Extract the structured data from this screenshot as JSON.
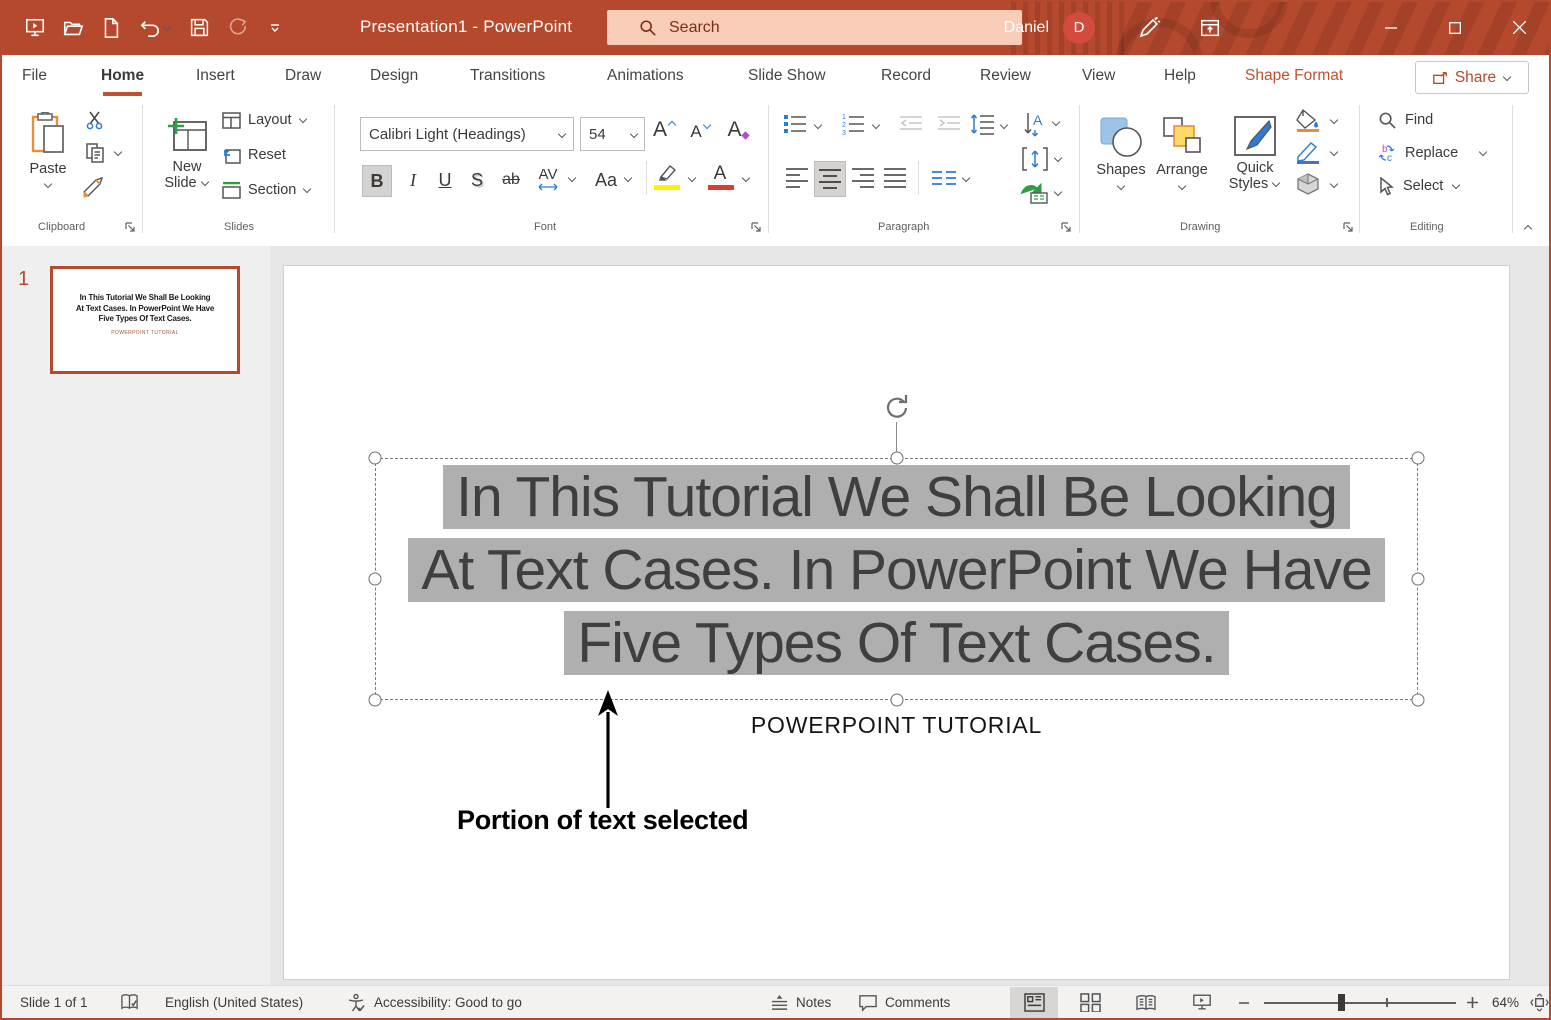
{
  "colors": {
    "accent": "#B5492D",
    "search_bg": "#F8CDB8",
    "selection_highlight": "#AFAFAF",
    "slide_text": "#3F3F3F",
    "contextual_tab": "#C0512F",
    "highlight_yellow": "#FFF200",
    "font_color_red": "#E03C31"
  },
  "titlebar": {
    "title": "Presentation1 - PowerPoint",
    "search_placeholder": "Search",
    "user_name": "Daniel",
    "user_initial": "D"
  },
  "tabs": [
    {
      "label": "File"
    },
    {
      "label": "Home"
    },
    {
      "label": "Insert"
    },
    {
      "label": "Draw"
    },
    {
      "label": "Design"
    },
    {
      "label": "Transitions"
    },
    {
      "label": "Animations"
    },
    {
      "label": "Slide Show"
    },
    {
      "label": "Record"
    },
    {
      "label": "Review"
    },
    {
      "label": "View"
    },
    {
      "label": "Help"
    },
    {
      "label": "Shape Format"
    }
  ],
  "share": {
    "label": "Share"
  },
  "ribbon": {
    "clipboard": {
      "label": "Clipboard",
      "paste_label": "Paste"
    },
    "slides": {
      "label": "Slides",
      "new_label_1": "New",
      "new_label_2": "Slide",
      "layout_label": "Layout",
      "reset_label": "Reset",
      "section_label": "Section"
    },
    "font": {
      "label": "Font",
      "font_name": "Calibri Light (Headings)",
      "font_size": "54",
      "bold": "B",
      "italic": "I",
      "underline": "U",
      "shadow": "S",
      "strikethrough": "ab",
      "char_spacing": "AV",
      "change_case": "Aa",
      "grow": "A",
      "shrink": "A",
      "clear": "A"
    },
    "paragraph": {
      "label": "Paragraph"
    },
    "drawing": {
      "label": "Drawing",
      "shapes_label": "Shapes",
      "arrange_label": "Arrange",
      "quick_label_1": "Quick",
      "quick_label_2": "Styles"
    },
    "editing": {
      "label": "Editing",
      "find_label": "Find",
      "replace_label": "Replace",
      "select_label": "Select"
    }
  },
  "thumbnail_panel": {
    "slide_number": "1"
  },
  "slide": {
    "title_line1": "In This Tutorial We Shall Be Looking",
    "title_line2": "At Text Cases. In PowerPoint We Have",
    "title_line3": "Five Types Of Text Cases.",
    "subtitle": "POWERPOINT TUTORIAL",
    "annotation": "Portion of text selected"
  },
  "statusbar": {
    "slide_info": "Slide 1 of 1",
    "language": "English (United States)",
    "accessibility": "Accessibility: Good to go",
    "notes_label": "Notes",
    "comments_label": "Comments",
    "zoom_level": "64%"
  }
}
